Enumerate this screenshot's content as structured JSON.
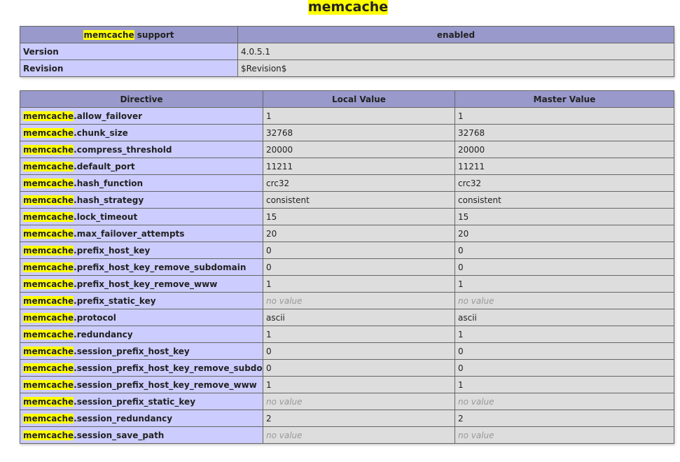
{
  "page": {
    "title": "memcache"
  },
  "support_table": {
    "header": {
      "left_highlight": "memcache",
      "left_suffix": " support",
      "right": "enabled"
    },
    "rows": [
      {
        "label": "Version",
        "value": "4.0.5.1"
      },
      {
        "label": "Revision",
        "value": "$Revision$"
      }
    ]
  },
  "directive_table": {
    "headers": [
      "Directive",
      "Local Value",
      "Master Value"
    ],
    "prefix": "memcache",
    "no_value_text": "no value",
    "rows": [
      {
        "suffix": ".allow_failover",
        "local": "1",
        "master": "1"
      },
      {
        "suffix": ".chunk_size",
        "local": "32768",
        "master": "32768"
      },
      {
        "suffix": ".compress_threshold",
        "local": "20000",
        "master": "20000"
      },
      {
        "suffix": ".default_port",
        "local": "11211",
        "master": "11211"
      },
      {
        "suffix": ".hash_function",
        "local": "crc32",
        "master": "crc32"
      },
      {
        "suffix": ".hash_strategy",
        "local": "consistent",
        "master": "consistent"
      },
      {
        "suffix": ".lock_timeout",
        "local": "15",
        "master": "15"
      },
      {
        "suffix": ".max_failover_attempts",
        "local": "20",
        "master": "20"
      },
      {
        "suffix": ".prefix_host_key",
        "local": "0",
        "master": "0"
      },
      {
        "suffix": ".prefix_host_key_remove_subdomain",
        "local": "0",
        "master": "0"
      },
      {
        "suffix": ".prefix_host_key_remove_www",
        "local": "1",
        "master": "1"
      },
      {
        "suffix": ".prefix_static_key",
        "local": "no value",
        "master": "no value"
      },
      {
        "suffix": ".protocol",
        "local": "ascii",
        "master": "ascii"
      },
      {
        "suffix": ".redundancy",
        "local": "1",
        "master": "1"
      },
      {
        "suffix": ".session_prefix_host_key",
        "local": "0",
        "master": "0"
      },
      {
        "suffix": ".session_prefix_host_key_remove_subdomain",
        "local": "0",
        "master": "0"
      },
      {
        "suffix": ".session_prefix_host_key_remove_www",
        "local": "1",
        "master": "1"
      },
      {
        "suffix": ".session_prefix_static_key",
        "local": "no value",
        "master": "no value"
      },
      {
        "suffix": ".session_redundancy",
        "local": "2",
        "master": "2"
      },
      {
        "suffix": ".session_save_path",
        "local": "no value",
        "master": "no value"
      }
    ]
  },
  "colors": {
    "header_bg": "#9999cc",
    "label_bg": "#ccccff",
    "value_bg": "#dddddd",
    "highlight": "#ffff00",
    "no_value": "#999999"
  }
}
